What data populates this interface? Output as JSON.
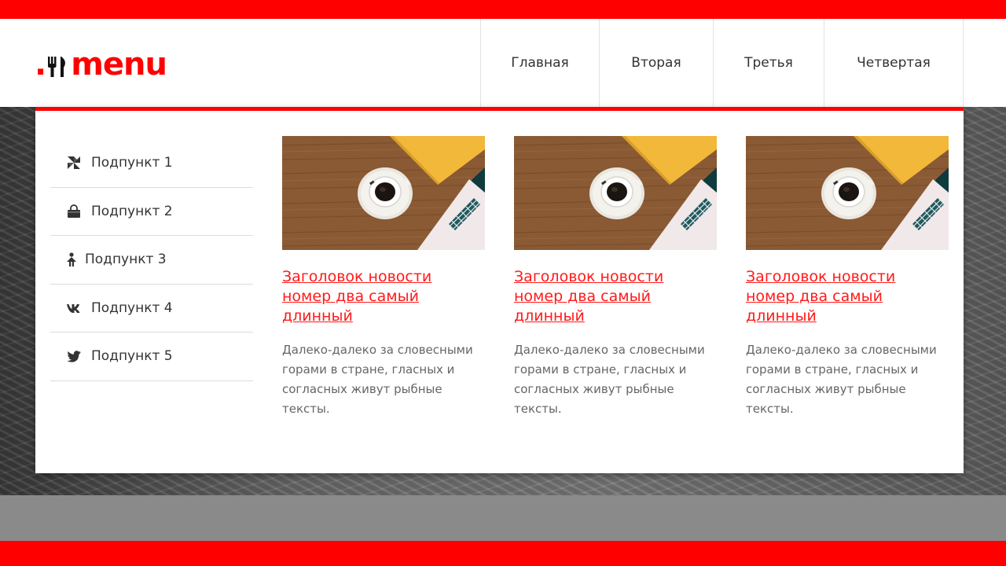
{
  "brand": {
    "logo_dot": ".",
    "logo_text": "menu",
    "accent_color": "#ff0000"
  },
  "nav": {
    "items": [
      {
        "label": "Главная"
      },
      {
        "label": "Вторая"
      },
      {
        "label": "Третья"
      },
      {
        "label": "Четвертая"
      }
    ]
  },
  "submenu": {
    "items": [
      {
        "label": "Подпункт 1",
        "icon": "pinwheel-icon"
      },
      {
        "label": "Подпункт 2",
        "icon": "shopping-bag-icon"
      },
      {
        "label": "Подпункт 3",
        "icon": "person-icon"
      },
      {
        "label": "Подпункт 4",
        "icon": "vk-icon"
      },
      {
        "label": "Подпункт 5",
        "icon": "twitter-icon"
      }
    ]
  },
  "cards": [
    {
      "title": "Заголовок новости номер два самый длинный",
      "text": "Далеко-далеко за словесными горами в стране, гласных и согласных живут рыбные тексты.",
      "image": "coffee-laptop-desk-image"
    },
    {
      "title": "Заголовок новости номер два самый длинный",
      "text": "Далеко-далеко за словесными горами в стране, гласных и согласных живут рыбные тексты.",
      "image": "coffee-laptop-desk-image"
    },
    {
      "title": "Заголовок новости номер два самый длинный",
      "text": "Далеко-далеко за словесными горами в стране, гласных и согласных живут рыбные тексты.",
      "image": "coffee-laptop-desk-image"
    }
  ]
}
